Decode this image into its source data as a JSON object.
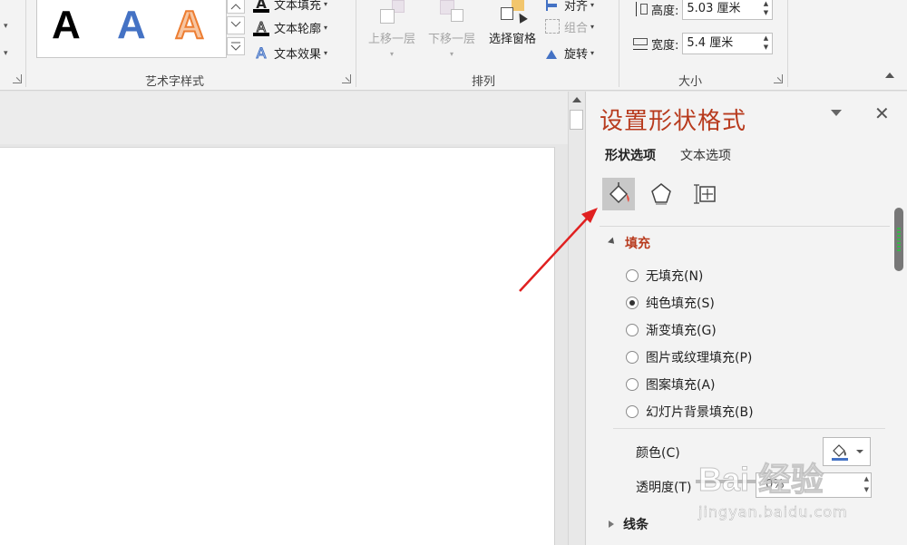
{
  "ribbon": {
    "wordart_styles": {
      "group_label": "艺术字样式",
      "samples": [
        "A",
        "A",
        "A"
      ],
      "text_fill": "文本填充",
      "text_outline": "文本轮廓",
      "text_effects": "文本效果"
    },
    "arrange": {
      "group_label": "排列",
      "bring_forward": "上移一层",
      "send_backward": "下移一层",
      "selection_pane": "选择窗格",
      "align": "对齐",
      "group": "组合",
      "rotate": "旋转"
    },
    "size": {
      "group_label": "大小",
      "height_label": "高度:",
      "height_value": "5.03 厘米",
      "width_label": "宽度:",
      "width_value": "5.4 厘米"
    }
  },
  "pane": {
    "title": "设置形状格式",
    "tabs": [
      "形状选项",
      "文本选项"
    ],
    "icons": [
      "fill-line-icon",
      "effects-icon",
      "size-properties-icon"
    ],
    "fill_section": {
      "label": "填充",
      "options": [
        "无填充(N)",
        "纯色填充(S)",
        "渐变填充(G)",
        "图片或纹理填充(P)",
        "图案填充(A)",
        "幻灯片背景填充(B)"
      ],
      "selected_index": 1,
      "color_label": "颜色(C)",
      "transparency_label": "透明度(T)",
      "transparency_value": "0%"
    },
    "line_section": {
      "label": "线条"
    }
  },
  "watermark": {
    "main": "Bai 经验",
    "sub": "jingyan.baidu.com"
  },
  "colors": {
    "pane_title": "#b83b1e",
    "accent_red": "#e02020",
    "fill_blue": "#4472c4"
  }
}
